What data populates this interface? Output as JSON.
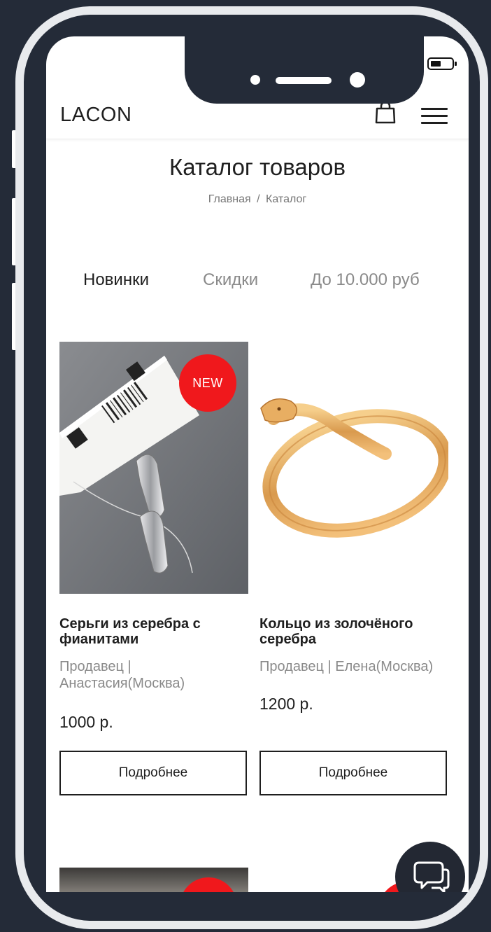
{
  "header": {
    "logo": "LACON"
  },
  "page": {
    "title": "Каталог товаров",
    "breadcrumb_home": "Главная",
    "breadcrumb_sep": "/",
    "breadcrumb_current": "Каталог"
  },
  "tabs": [
    {
      "label": "Новинки",
      "active": true
    },
    {
      "label": "Скидки",
      "active": false
    },
    {
      "label": "До 10.000 руб",
      "active": false
    }
  ],
  "products": [
    {
      "name": "Серьги из серебра с фианитами",
      "seller": "Продавец | Анастасия(Москва)",
      "price": "1000 р.",
      "badge": "NEW",
      "button": "Подробнее"
    },
    {
      "name": "Кольцо из золочёного серебра",
      "seller": "Продавец | Елена(Москва)",
      "price": "1200 р.",
      "button": "Подробнее"
    }
  ],
  "colors": {
    "accent": "#f0181c",
    "phone_bg": "#242b38",
    "text": "#1f1f1f",
    "muted": "#8a8a8a"
  },
  "icons": [
    "cart-icon",
    "menu-icon",
    "chat-icon",
    "signal-icon",
    "wifi-icon",
    "battery-icon"
  ]
}
